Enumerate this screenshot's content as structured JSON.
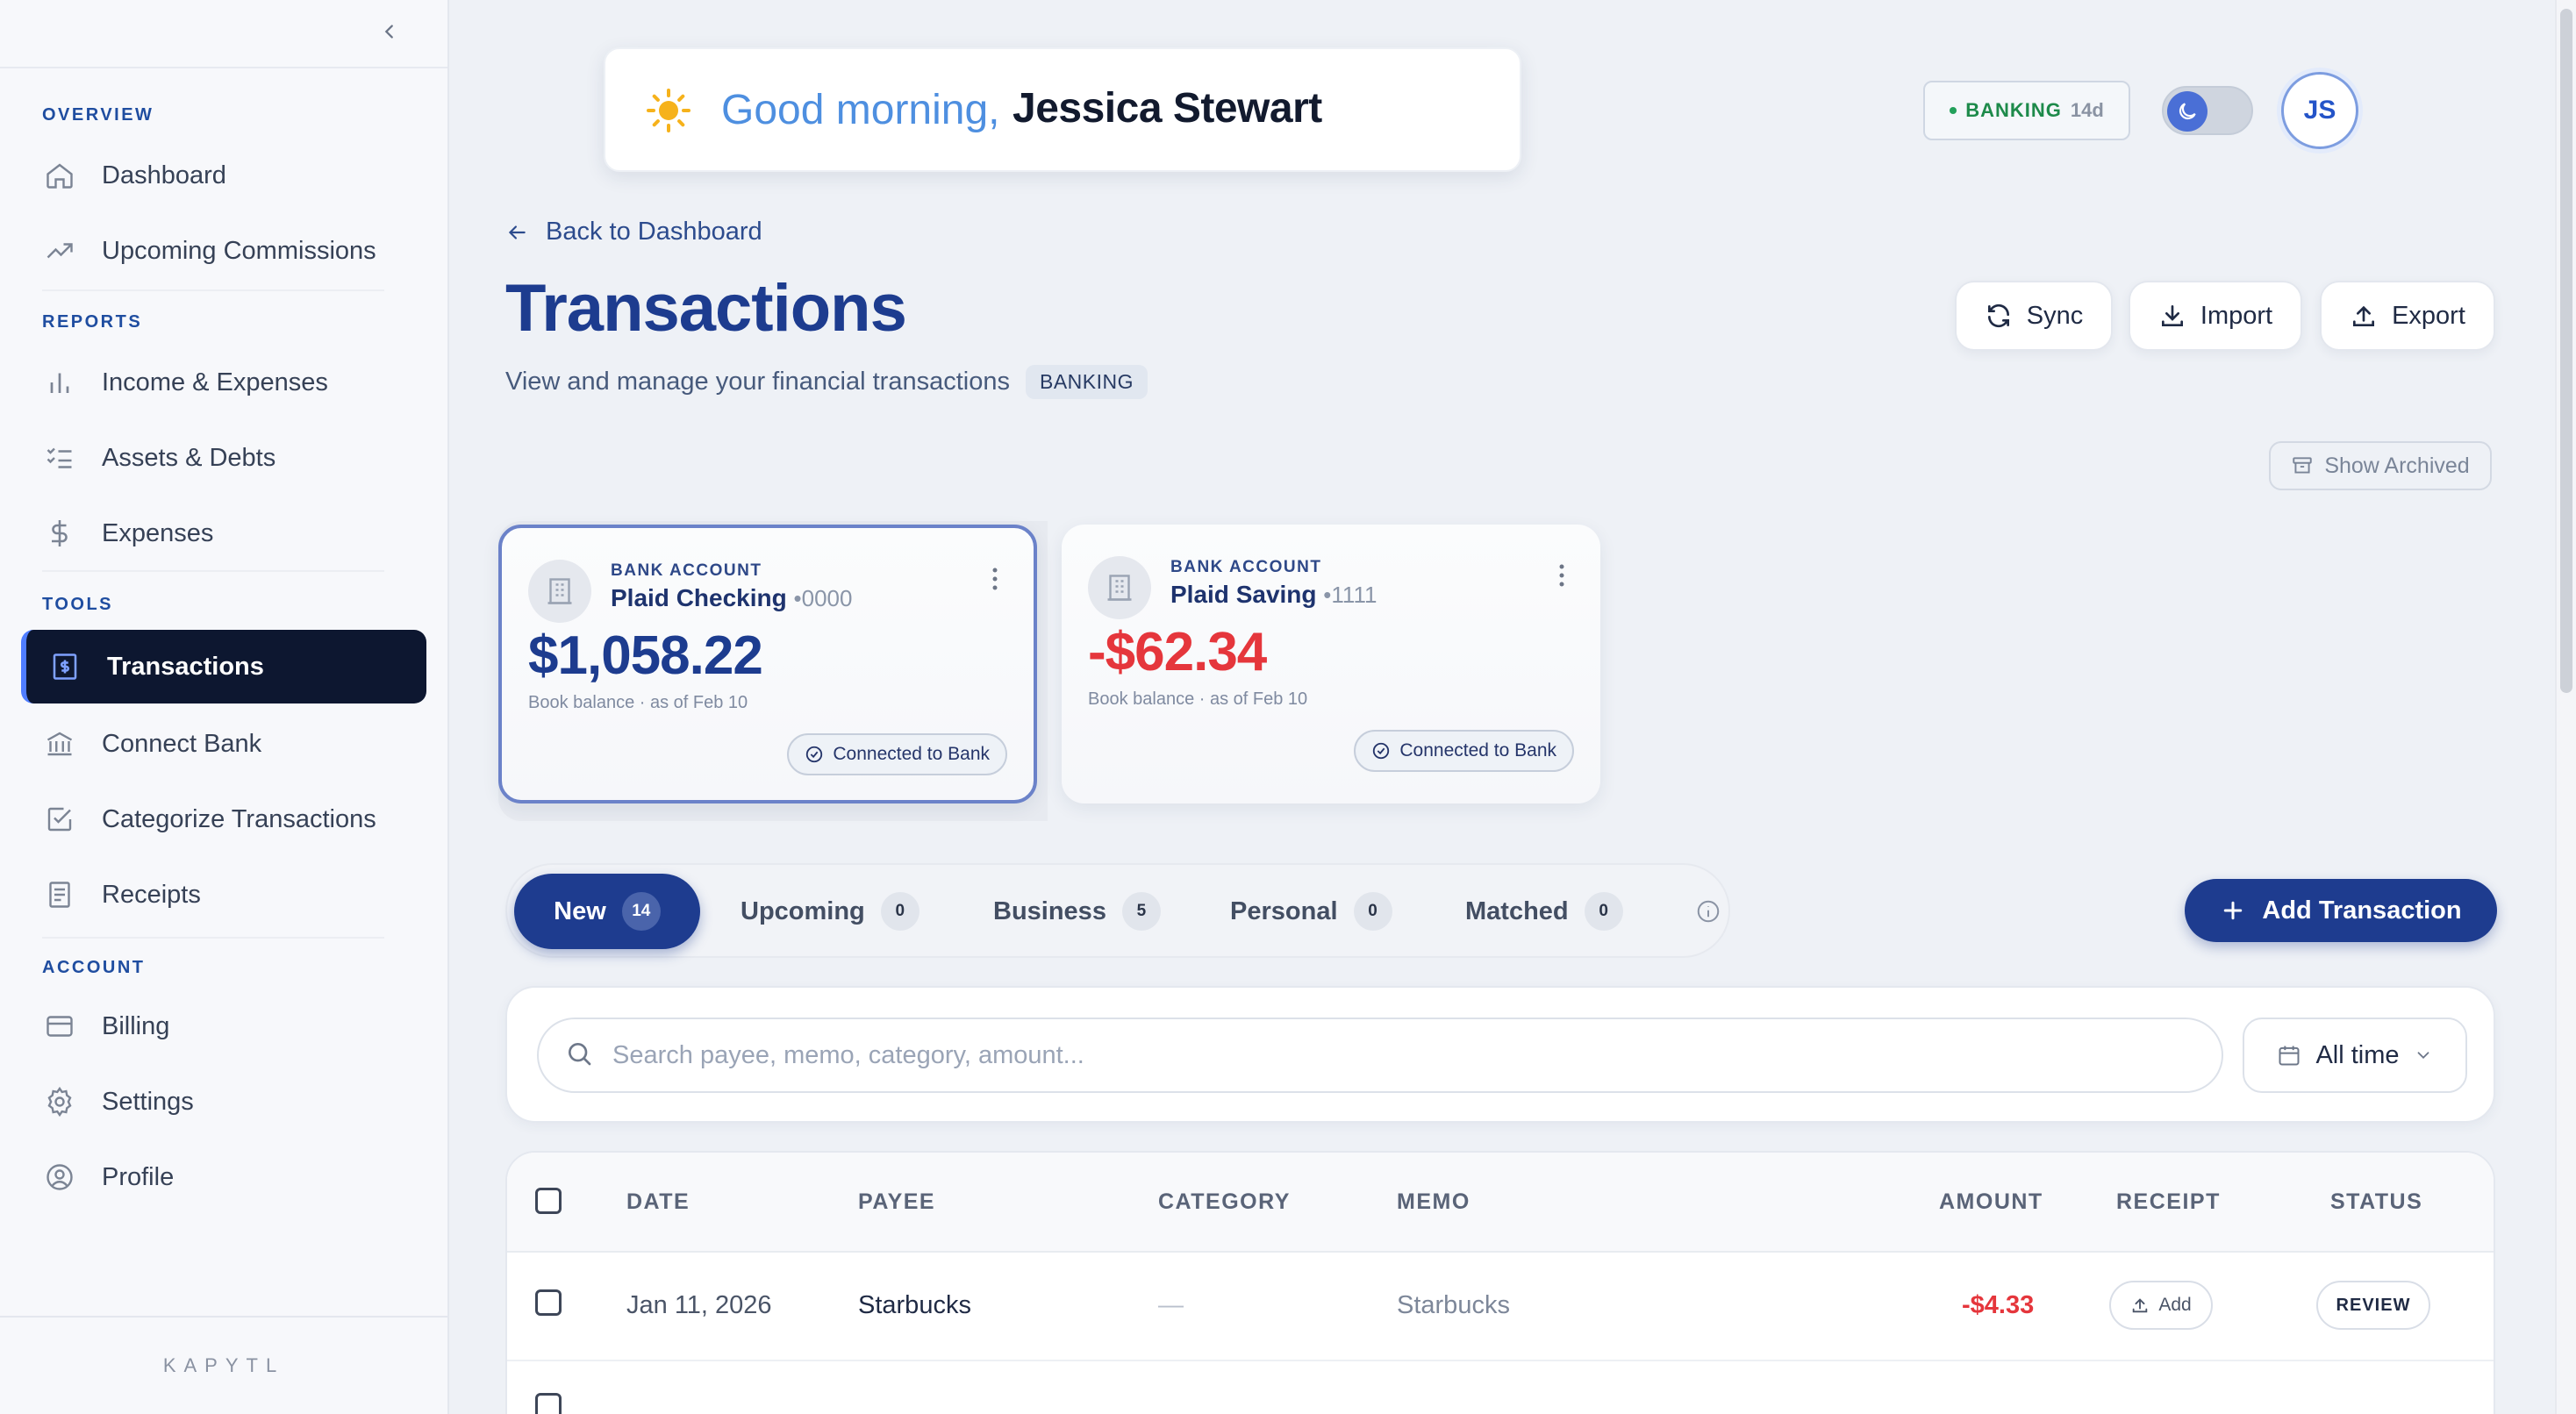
{
  "sidebar": {
    "sections": {
      "overview": "OVERVIEW",
      "reports": "REPORTS",
      "tools": "TOOLS",
      "account": "ACCOUNT"
    },
    "items": {
      "dashboard": "Dashboard",
      "upcoming_commissions": "Upcoming Commissions",
      "income_expenses": "Income & Expenses",
      "assets_debts": "Assets & Debts",
      "expenses": "Expenses",
      "transactions": "Transactions",
      "connect_bank": "Connect Bank",
      "categorize": "Categorize Transactions",
      "receipts": "Receipts",
      "billing": "Billing",
      "settings": "Settings",
      "profile": "Profile"
    },
    "active": "transactions",
    "brand": "KAPYTL"
  },
  "header": {
    "greeting": "Good morning,",
    "user_name": "Jessica Stewart",
    "plan_badge": "BANKING",
    "plan_days": "14d",
    "avatar_initials": "JS"
  },
  "page": {
    "back_link": "Back to Dashboard",
    "title": "Transactions",
    "subtitle": "View and manage your financial transactions",
    "tag": "BANKING",
    "actions": {
      "sync": "Sync",
      "import": "Import",
      "export": "Export"
    },
    "show_archived": "Show Archived"
  },
  "accounts": [
    {
      "label": "BANK ACCOUNT",
      "name": "Plaid Checking",
      "mask": "•0000",
      "balance": "$1,058.22",
      "meta": "Book balance · as of Feb 10",
      "status": "Connected to Bank"
    },
    {
      "label": "BANK ACCOUNT",
      "name": "Plaid Saving",
      "mask": "•1111",
      "balance": "-$62.34",
      "meta": "Book balance · as of Feb 10",
      "status": "Connected to Bank"
    }
  ],
  "tabs": [
    {
      "label": "New",
      "count": "14"
    },
    {
      "label": "Upcoming",
      "count": "0"
    },
    {
      "label": "Business",
      "count": "5"
    },
    {
      "label": "Personal",
      "count": "0"
    },
    {
      "label": "Matched",
      "count": "0"
    }
  ],
  "add_transaction": "Add Transaction",
  "search": {
    "placeholder": "Search payee, memo, category, amount...",
    "time_filter": "All time"
  },
  "table": {
    "columns": {
      "date": "DATE",
      "payee": "PAYEE",
      "category": "CATEGORY",
      "memo": "MEMO",
      "amount": "AMOUNT",
      "receipt": "RECEIPT",
      "status": "STATUS"
    },
    "rows": [
      {
        "date": "Jan 11, 2026",
        "payee": "Starbucks",
        "category": "—",
        "memo": "Starbucks",
        "amount": "-$4.33",
        "receipt": "Add",
        "status": "REVIEW"
      }
    ]
  }
}
